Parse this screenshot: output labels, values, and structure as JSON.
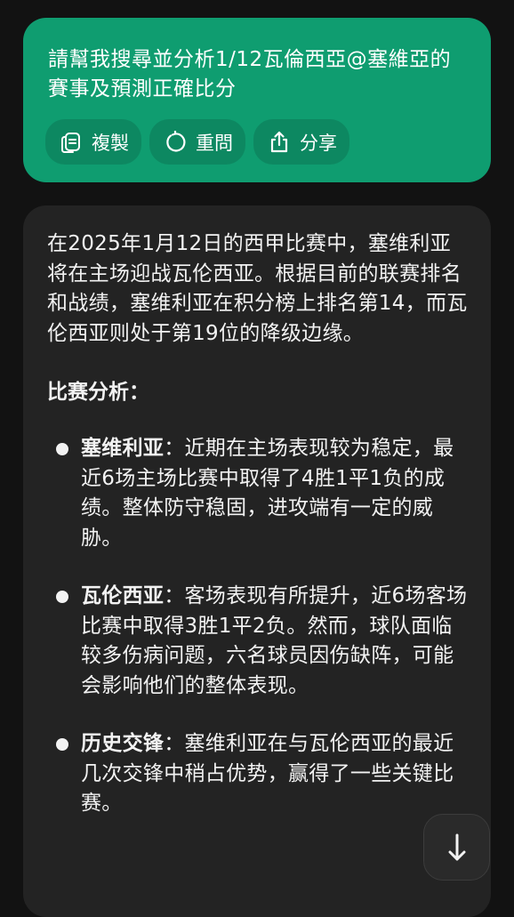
{
  "user_message": {
    "text": "請幫我搜尋並分析1/12瓦倫西亞@塞維亞的賽事及預測正確比分"
  },
  "actions": [
    {
      "label": "複製",
      "icon": "copy-icon"
    },
    {
      "label": "重問",
      "icon": "refresh-icon"
    },
    {
      "label": "分享",
      "icon": "share-icon"
    }
  ],
  "answer": {
    "intro": "在2025年1月12日的西甲比赛中，塞维利亚将在主场迎战瓦伦西亚。根据目前的联赛排名和战绩，塞维利亚在积分榜上排名第14，而瓦伦西亚则处于第19位的降级边缘。",
    "section_heading": "比赛分析：",
    "bullets": [
      {
        "title": "塞维利亚",
        "text": "：近期在主场表现较为稳定，最近6场主场比赛中取得了4胜1平1负的成绩。整体防守稳固，进攻端有一定的威胁。"
      },
      {
        "title": "瓦伦西亚",
        "text": "：客场表现有所提升，近6场客场比赛中取得3胜1平2负。然而，球队面临较多伤病问题，六名球员因伤缺阵，可能会影响他们的整体表现。"
      },
      {
        "title": "历史交锋",
        "text": "：塞维利亚在与瓦伦西亚的最近几次交锋中稍占优势，赢得了一些关键比赛。"
      }
    ]
  },
  "scroll_button": {
    "icon": "arrow-down-icon"
  },
  "colors": {
    "background": "#121212",
    "user_bubble": "#0f9d70",
    "answer_card": "#232323",
    "text": "#f2f2f2"
  }
}
